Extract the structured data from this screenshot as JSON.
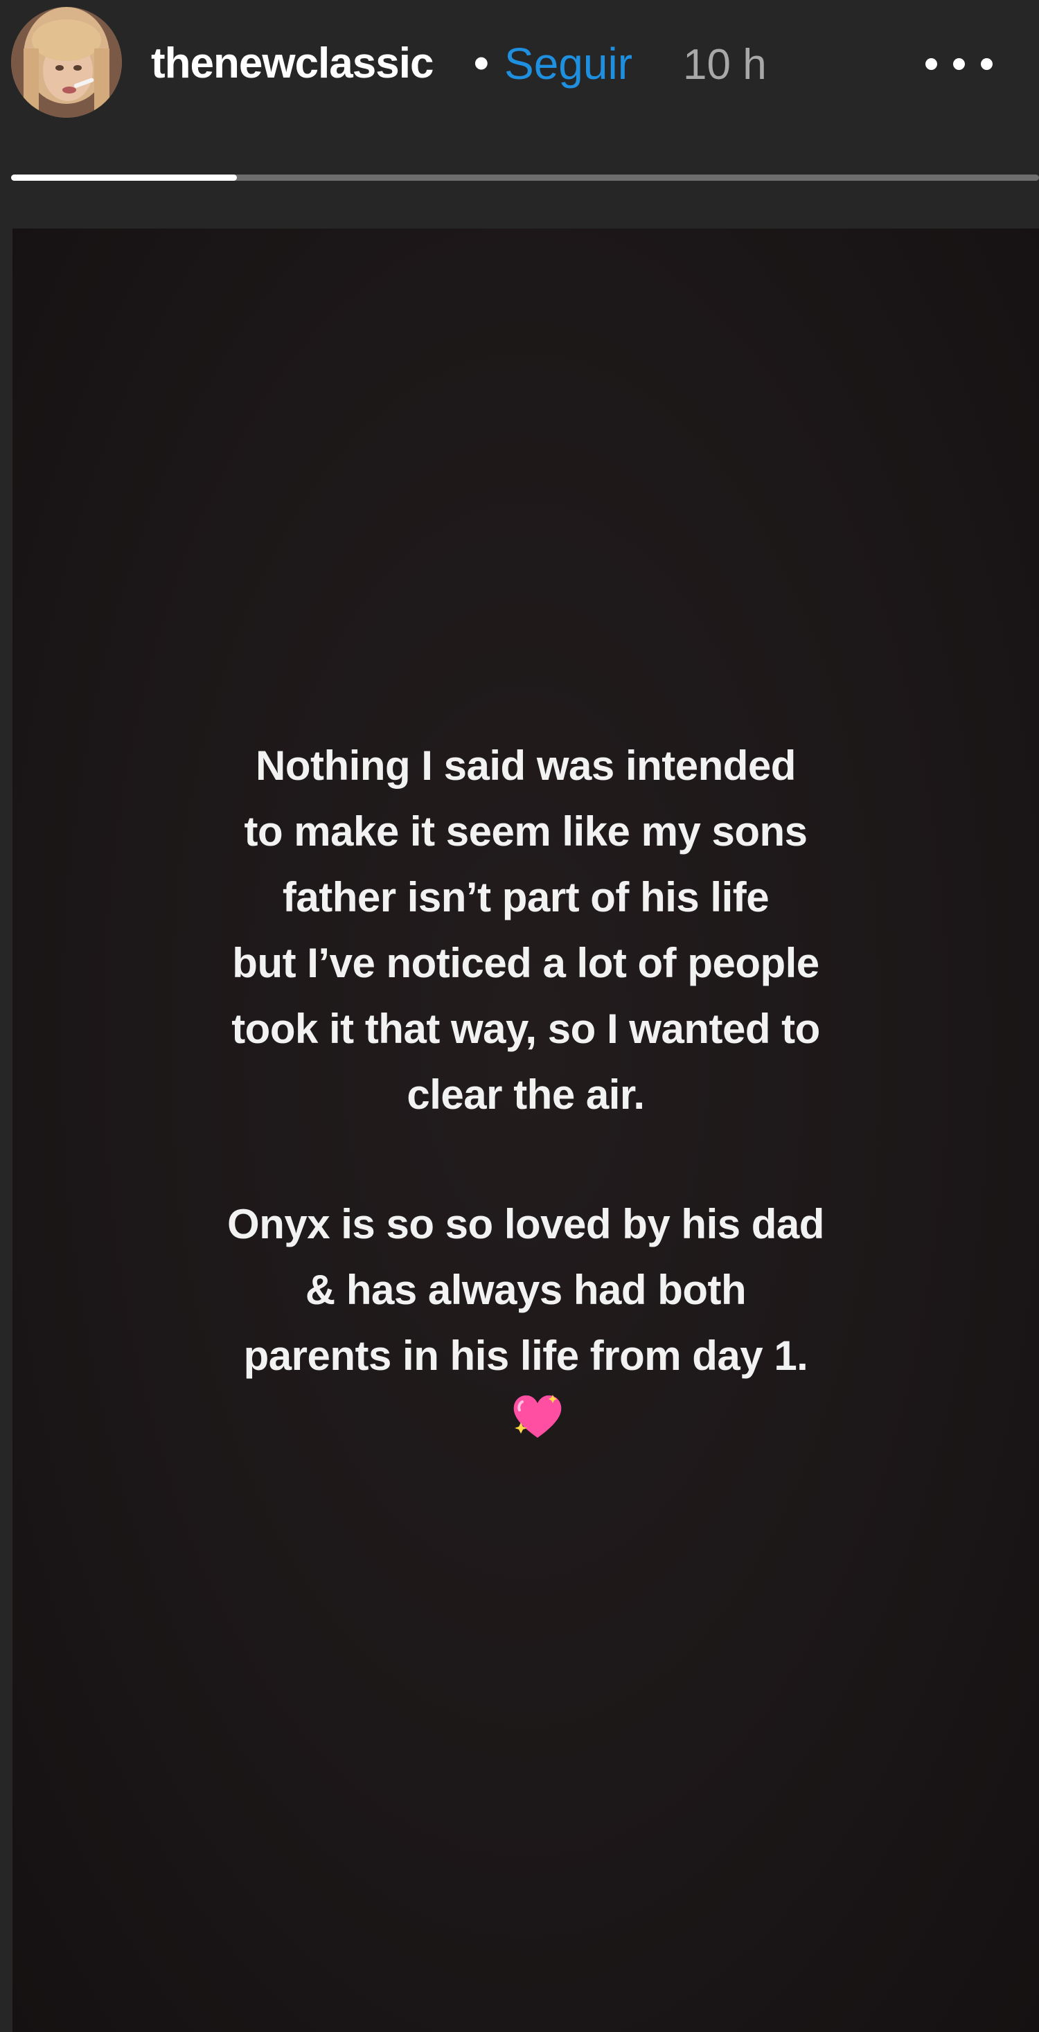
{
  "header": {
    "username": "thenewclassic",
    "separator": "•",
    "follow_label": "Seguir",
    "time_ago": "10 h",
    "more_icon": "more-horizontal-icon"
  },
  "progress": {
    "segments": 1,
    "current_fraction": 0.22
  },
  "story": {
    "paragraph1": [
      "Nothing I said was intended",
      "to make it seem like my sons",
      "father isn’t part of his life",
      "but I’ve noticed a lot of people",
      "took it that way, so I wanted to",
      "clear the air."
    ],
    "paragraph2": [
      "Onyx is so so loved by his dad",
      "& has always had both",
      "parents in his life from day 1."
    ],
    "emoji": "sparkling-heart-icon"
  },
  "colors": {
    "accent": "#1f8fe0",
    "background": "#262626",
    "story_background": "#1c1718",
    "heart": "#ff4fa3"
  }
}
